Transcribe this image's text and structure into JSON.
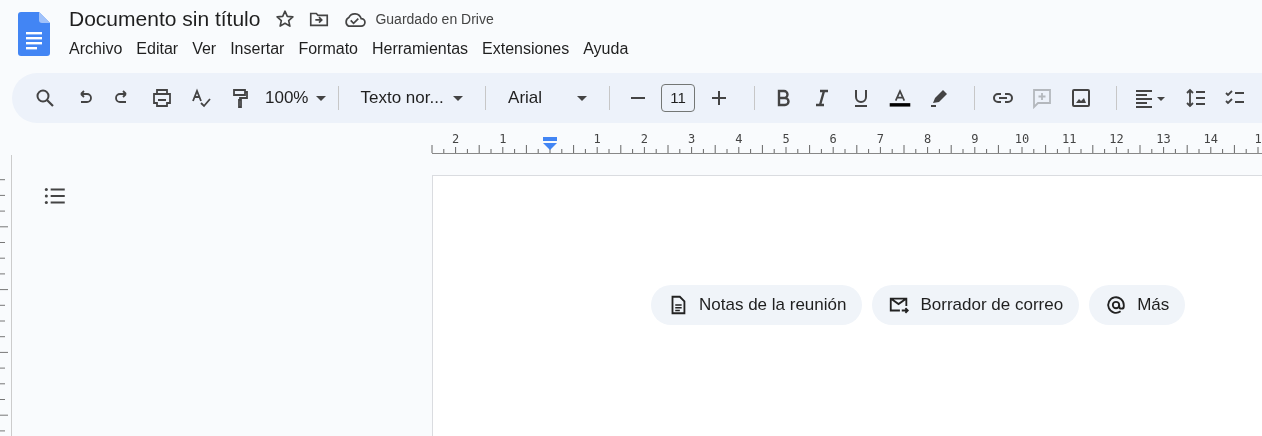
{
  "document": {
    "title": "Documento sin título",
    "save_status": "Guardado en Drive"
  },
  "menu": [
    "Archivo",
    "Editar",
    "Ver",
    "Insertar",
    "Formato",
    "Herramientas",
    "Extensiones",
    "Ayuda"
  ],
  "toolbar": {
    "zoom": "100%",
    "paragraph_style": "Texto nor...",
    "font": "Arial",
    "font_size": "11",
    "comment_disabled": true
  },
  "ruler": {
    "left_labels": [
      "2",
      "1"
    ],
    "right_labels": [
      "1",
      "2",
      "3",
      "4",
      "5",
      "6",
      "7",
      "8",
      "9",
      "10",
      "11",
      "12",
      "13",
      "14",
      "1"
    ]
  },
  "chips": [
    {
      "kind": "document",
      "label": "Notas de la reunión"
    },
    {
      "kind": "email",
      "label": "Borrador de correo"
    },
    {
      "kind": "at",
      "label": "Más"
    }
  ]
}
